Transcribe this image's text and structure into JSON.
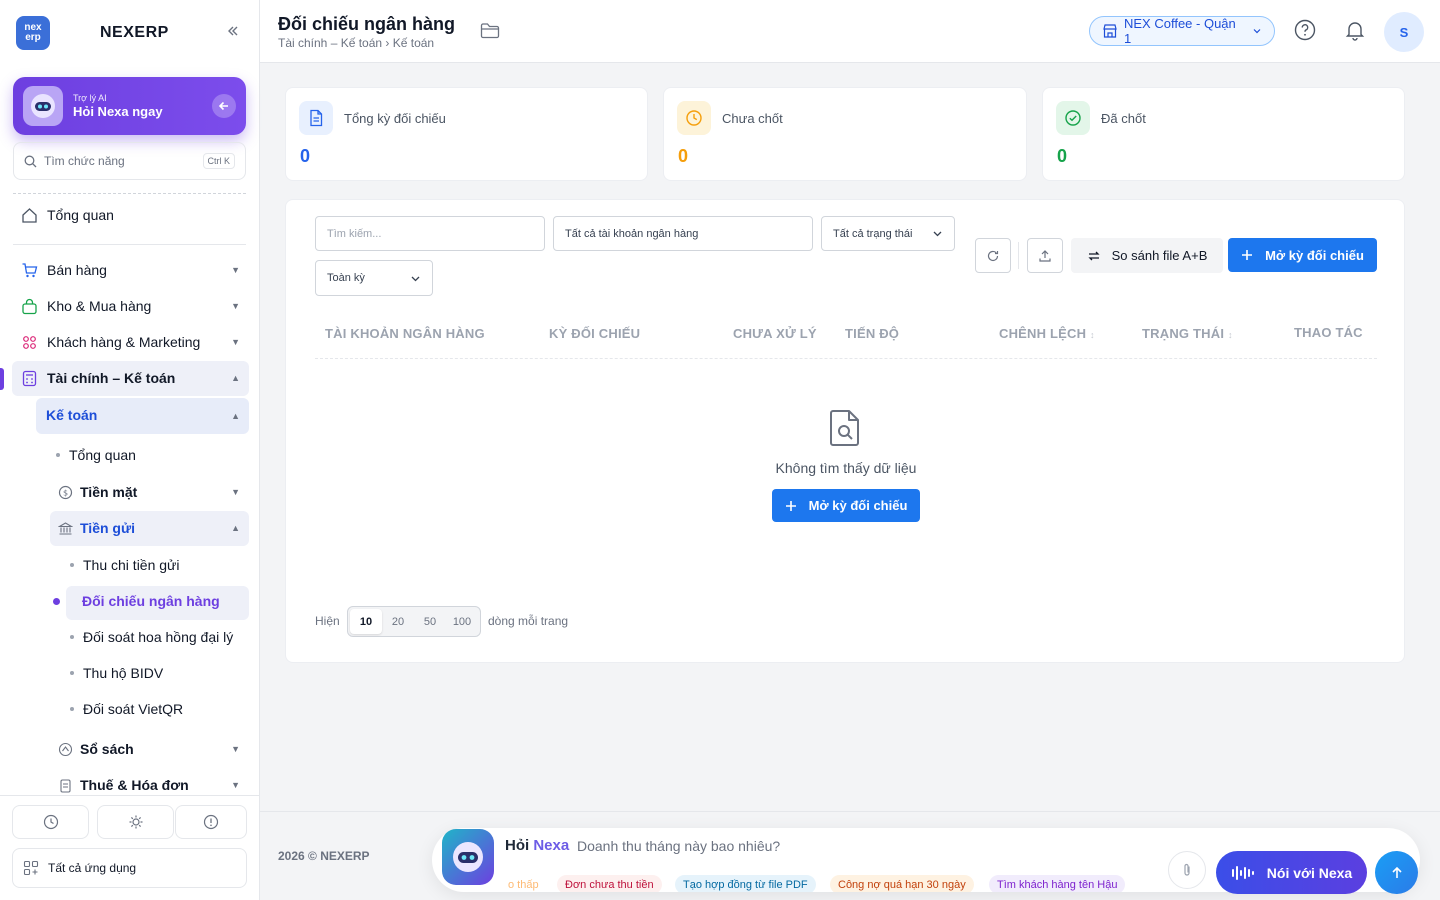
{
  "brand": {
    "name": "NEXERP",
    "logo_top": "nex",
    "logo_bottom": "erp"
  },
  "ai_card": {
    "small": "Trợ lý AI",
    "title": "Hỏi Nexa ngay"
  },
  "search": {
    "placeholder": "Tìm chức năng",
    "shortcut": "Ctrl K"
  },
  "sidebar": {
    "overview": "Tổng quan",
    "sales": "Bán hàng",
    "inventory": "Kho & Mua hàng",
    "crm": "Khách hàng & Marketing",
    "finance": "Tài chính – Kế toán",
    "accounting": "Kế toán",
    "acc_overview": "Tổng quan",
    "cash": "Tiền mặt",
    "deposit": "Tiền gửi",
    "deposit_inout": "Thu chi tiền gửi",
    "bank_recon": "Đối chiếu ngân hàng",
    "agent_commission": "Đối soát hoa hồng đại lý",
    "bidv": "Thu hộ BIDV",
    "vietqr": "Đối soát VietQR",
    "books": "Sổ sách",
    "tax": "Thuế & Hóa đơn",
    "all_apps": "Tất cả ứng dụng"
  },
  "header": {
    "title": "Đối chiếu ngân hàng",
    "breadcrumb": "Tài chính – Kế toán › Kế toán",
    "branch": "NEX Coffee - Quận 1",
    "avatar": "S"
  },
  "stats": [
    {
      "label": "Tổng kỳ đối chiếu",
      "value": "0",
      "color": "#2563eb"
    },
    {
      "label": "Chưa chốt",
      "value": "0",
      "color": "#f59e0b"
    },
    {
      "label": "Đã chốt",
      "value": "0",
      "color": "#16a34a"
    }
  ],
  "filters": {
    "search_placeholder": "Tìm kiếm...",
    "account": "Tất cả tài khoản ngân hàng",
    "status": "Tất cả trạng thái",
    "period": "Toàn kỳ"
  },
  "toolbar": {
    "compare": "So sánh file A+B",
    "open_period": "Mở kỳ đối chiếu"
  },
  "table": {
    "columns": [
      "TÀI KHOẢN NGÂN HÀNG",
      "KỲ ĐỐI CHIẾU",
      "CHƯA XỬ LÝ",
      "TIẾN ĐỘ",
      "CHÊNH LỆCH",
      "TRẠNG THÁI",
      "THAO TÁC"
    ],
    "empty": "Không tìm thấy dữ liệu",
    "empty_action": "Mở kỳ đối chiếu"
  },
  "pagination": {
    "prefix": "Hiện",
    "sizes": [
      "10",
      "20",
      "50",
      "100"
    ],
    "suffix": "dòng mỗi trang"
  },
  "footer": {
    "copyright": "2026 © NEXERP"
  },
  "ask": {
    "title_prefix": "Hỏi ",
    "title_name": "Nexa",
    "question": "Doanh thu tháng này bao nhiêu?",
    "chips": [
      "o thấp",
      "Đơn chưa thu tiền",
      "Tạo hợp đồng từ file PDF",
      "Công nợ quá hạn 30 ngày",
      "Tìm khách hàng tên Hậu"
    ],
    "voice": "Nói với Nexa"
  },
  "colors": {
    "accent": "#6d3fe0",
    "primary": "#1d77ee"
  }
}
